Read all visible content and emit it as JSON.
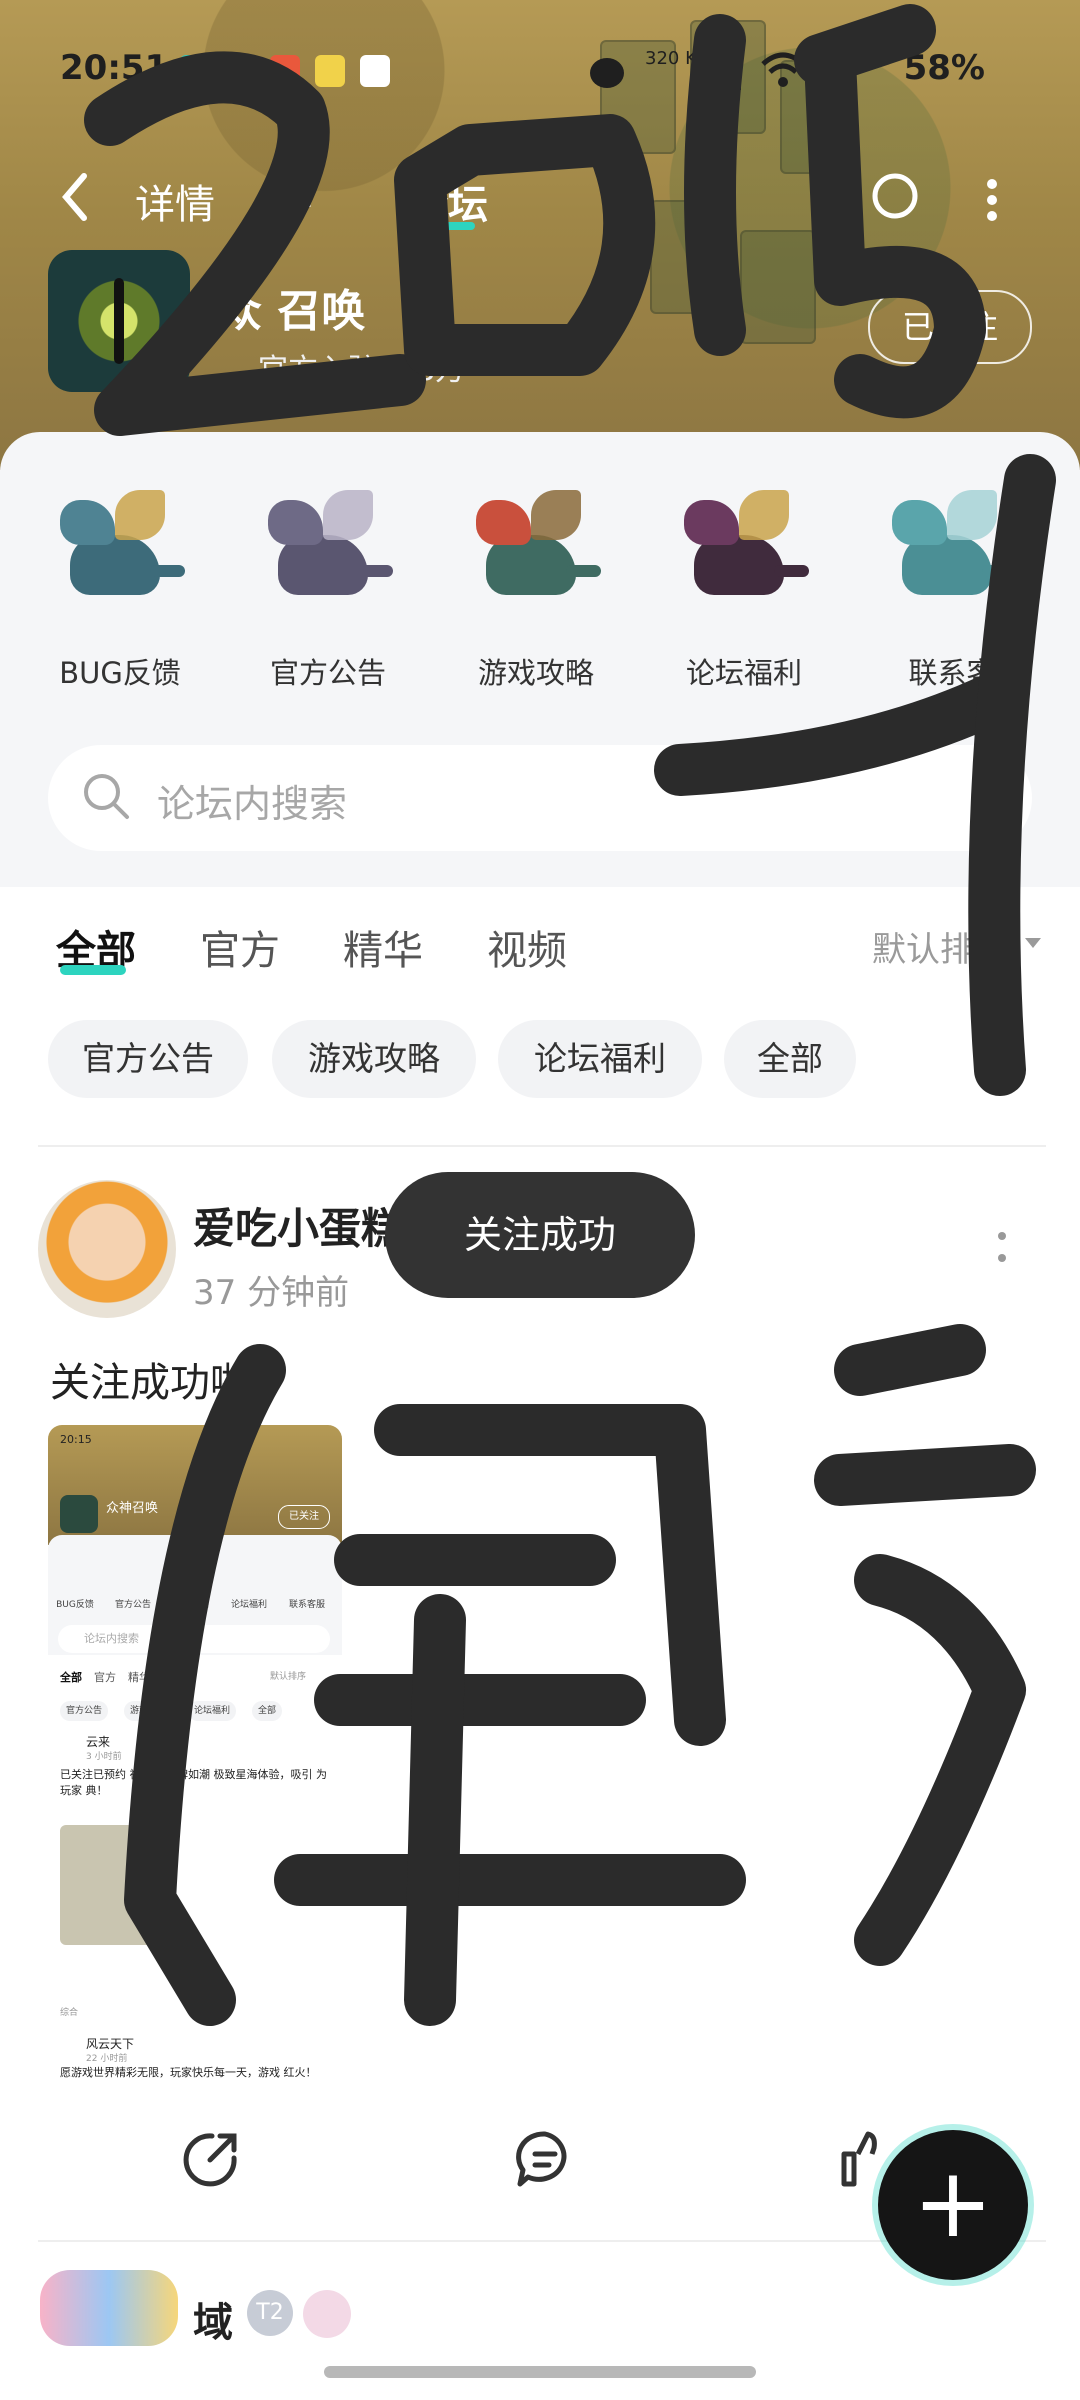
{
  "status_bar": {
    "time": "20:51",
    "network_speed": "320 KB/s",
    "signal_label": "5G",
    "battery": "58%"
  },
  "nav": {
    "back_icon": "chevron-left-icon",
    "tabs": [
      {
        "label": "详情"
      },
      {
        "label": "评"
      },
      {
        "label": "论坛"
      }
    ],
    "active_tab": "论坛",
    "share_icon": "share-icon",
    "more_icon": "more-vertical-icon"
  },
  "game": {
    "name": "众神召唤",
    "name_visible": "众  召唤",
    "meta": "官方入驻  1.8万",
    "follow_label": "已关注"
  },
  "categories": [
    {
      "label": "BUG反馈",
      "color": "#3d6b7a"
    },
    {
      "label": "官方公告",
      "color": "#5a5670"
    },
    {
      "label": "游戏攻略",
      "color": "#c9503d"
    },
    {
      "label": "论坛福利",
      "color": "#402b3d"
    },
    {
      "label": "联系客",
      "color": "#4b8f95"
    }
  ],
  "search": {
    "placeholder": "论坛内搜索"
  },
  "tabs": {
    "items": [
      "全部",
      "官方",
      "精华",
      "视频"
    ],
    "sort_label": "默认排序"
  },
  "chips": [
    "官方公告",
    "游戏攻略",
    "论坛福利",
    "全部"
  ],
  "post": {
    "author": "爱吃小蛋糕",
    "time": "37 分钟前",
    "text": "关注成功啦",
    "toast": "关注成功",
    "thumbnail": {
      "time": "20:15",
      "game_name": "众神召唤",
      "follow": "已关注",
      "cats": [
        "BUG反馈",
        "官方公告",
        "游戏攻略",
        "论坛福利",
        "联系客服"
      ],
      "search": "论坛内搜索",
      "tabs": [
        "全部",
        "官方",
        "精华"
      ],
      "sort": "默认排序",
      "chips": [
        "官方公告",
        "游戏攻略",
        "论坛福利",
        "全部"
      ],
      "user1": "云来",
      "time1": "3 小时前",
      "body1": "已关注已预约 祝玩家 口碑如潮 极致星海体验，吸引 为玩家 典！",
      "label_section": "综合",
      "user2": "风云天下",
      "time2": "22 小时前",
      "body2": "愿游戏世界精彩无限，玩家快乐每一天，游戏 红火！"
    }
  },
  "actions": {
    "share_icon": "share-arrow-icon",
    "comment_icon": "comment-icon",
    "like_icon": "thumbs-up-icon",
    "fab_icon": "plus-icon"
  },
  "next_post": {
    "author": "域",
    "badge": "T2"
  },
  "overlay": {
    "handwriting": [
      "2015",
      "4",
      "缸级"
    ],
    "ink_color": "#2b2b2b"
  },
  "colors": {
    "accent": "#2dd4bf",
    "toast_bg": "#333333"
  }
}
